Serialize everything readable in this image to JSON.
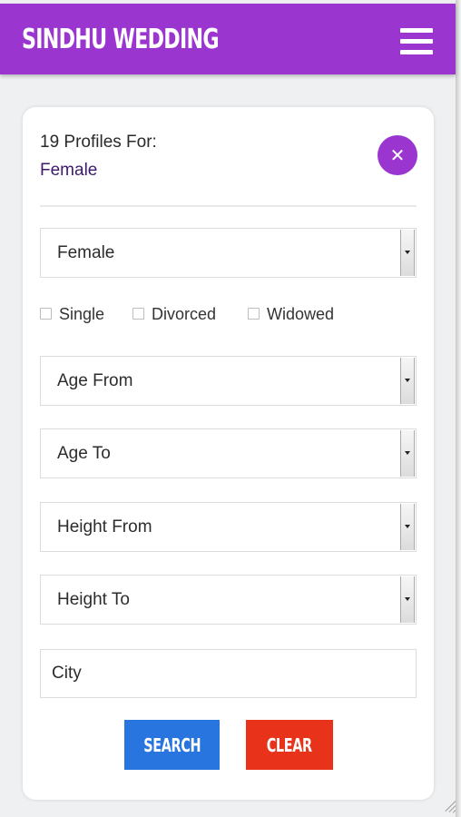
{
  "navbar": {
    "brand": "SINDHU WEDDING",
    "menu_icon": "hamburger-menu-icon"
  },
  "filter_card": {
    "count": "19",
    "count_suffix": " Profiles For:",
    "selected_gender": "Female",
    "close_icon": "close-icon",
    "close_glyph": "✕",
    "gender_select": {
      "value": "Female"
    },
    "marital_status": [
      {
        "label": "Single",
        "checked": false
      },
      {
        "label": "Divorced",
        "checked": false
      },
      {
        "label": "Widowed",
        "checked": false
      }
    ],
    "age_from": {
      "value": "Age From"
    },
    "age_to": {
      "value": "Age To"
    },
    "height_from": {
      "value": "Height From"
    },
    "height_to": {
      "value": "Height To"
    },
    "city": {
      "placeholder": "City"
    },
    "search_label": "SEARCH",
    "clear_label": "CLEAR"
  },
  "colors": {
    "navbar": "#9b35cf",
    "close_button": "#9b35cf",
    "search_button": "#2975df",
    "clear_button": "#e8321a",
    "gender_text": "#3d1a6a"
  }
}
